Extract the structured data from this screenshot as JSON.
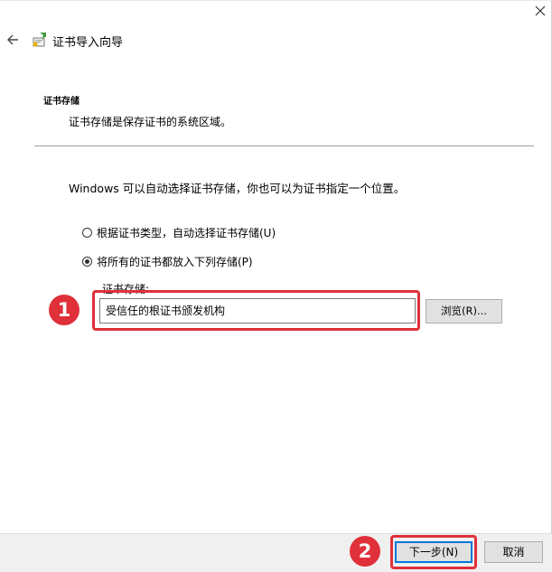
{
  "window": {
    "title": "证书导入向导"
  },
  "header": {
    "section_title": "证书存储",
    "section_description": "证书存储是保存证书的系统区域。"
  },
  "main": {
    "intro": "Windows 可以自动选择证书存储，你也可以为证书指定一个位置。",
    "options": [
      {
        "label": "根据证书类型，自动选择证书存储(U)",
        "selected": false
      },
      {
        "label": "将所有的证书都放入下列存储(P)",
        "selected": true
      }
    ],
    "store_label": "证书存储:",
    "store_value": "受信任的根证书颁发机构",
    "browse_label": "浏览(R)..."
  },
  "footer": {
    "next_label": "下一步(N)",
    "cancel_label": "取消"
  },
  "annotations": {
    "badge_1": "1",
    "badge_2": "2",
    "highlight_color": "#e0303a"
  },
  "icons": [
    "close-icon",
    "back-arrow-icon",
    "certificate-wizard-icon"
  ]
}
